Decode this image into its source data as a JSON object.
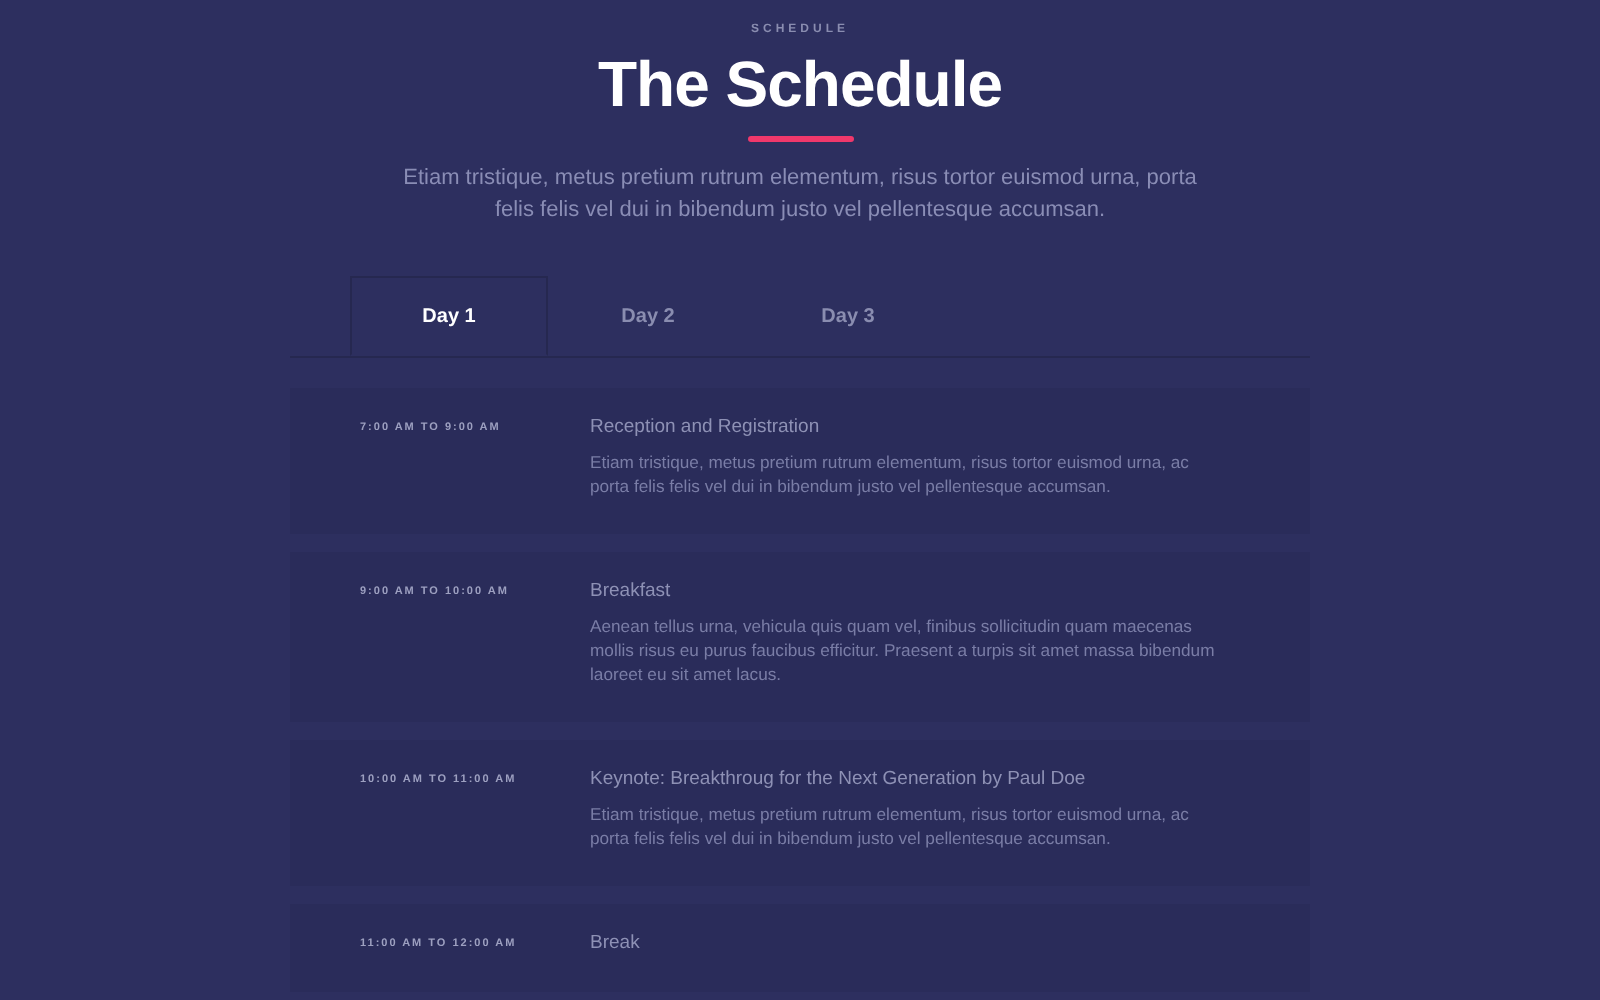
{
  "header": {
    "eyebrow": "SCHEDULE",
    "title": "The Schedule",
    "intro": "Etiam tristique, metus pretium rutrum elementum, risus tortor euismod urna, porta felis felis vel dui in bibendum justo vel pellentesque accumsan."
  },
  "tabs": [
    {
      "label": "Day 1",
      "selected": true
    },
    {
      "label": "Day 2",
      "selected": false
    },
    {
      "label": "Day 3",
      "selected": false
    }
  ],
  "sessions": [
    {
      "time": "7:00 AM TO 9:00 AM",
      "title": "Reception and Registration",
      "description": "Etiam tristique, metus pretium rutrum elementum, risus tortor euismod urna, ac porta felis felis vel dui in bibendum justo vel pellentesque accumsan."
    },
    {
      "time": "9:00 AM TO 10:00 AM",
      "title": "Breakfast",
      "description": "Aenean tellus urna, vehicula quis quam vel, finibus sollicitudin quam maecenas mollis risus eu purus faucibus efficitur. Praesent a turpis sit amet massa bibendum laoreet eu sit amet lacus."
    },
    {
      "time": "10:00 AM TO 11:00 AM",
      "title": "Keynote: Breakthroug for the Next Generation by Paul Doe",
      "description": "Etiam tristique, metus pretium rutrum elementum, risus tortor euismod urna, ac porta felis felis vel dui in bibendum justo vel pellentesque accumsan."
    },
    {
      "time": "11:00 AM TO 12:00 AM",
      "title": "Break"
    }
  ]
}
